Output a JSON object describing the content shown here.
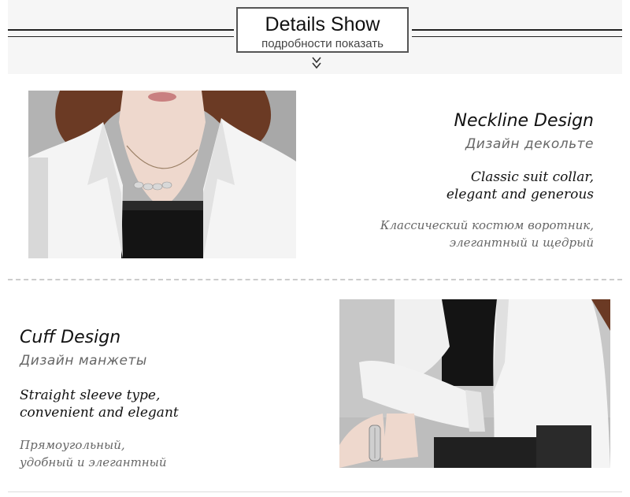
{
  "header": {
    "title": "Details Show",
    "subtitle": "подробности показать"
  },
  "neckline": {
    "title": "Neckline Design",
    "title_ru": "Дизайн декольте",
    "desc_line1": "Classic suit collar,",
    "desc_line2": "elegant and generous",
    "desc_ru_line1": "Классический костюм воротник,",
    "desc_ru_line2": "элегантный и щедрый"
  },
  "cuff": {
    "title": "Cuff Design",
    "title_ru": "Дизайн манжеты",
    "desc_line1": "Straight sleeve type,",
    "desc_line2": "convenient and elegant",
    "desc_ru_line1": "Прямоугольный,",
    "desc_ru_line2": "удобный и элегантный"
  },
  "colors": {
    "jacket": "#f4f4f4",
    "top": "#141414",
    "hair": "#6b3a24",
    "background": "#ffffff"
  },
  "icons": [
    "double-chevron-down-icon"
  ]
}
